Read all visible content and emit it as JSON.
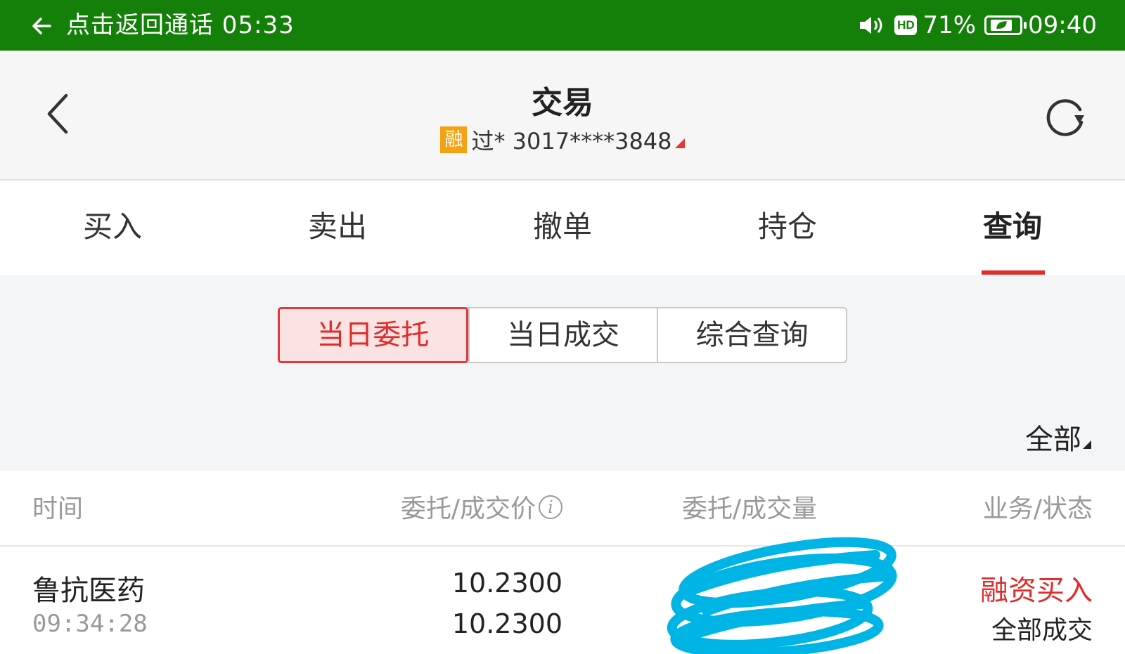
{
  "status_bar": {
    "call_text": "点击返回通话 05:33",
    "hd": "HD",
    "battery": "71%",
    "time": "09:40"
  },
  "header": {
    "title": "交易",
    "badge": "融",
    "account": "过* 3017****3848"
  },
  "tabs": [
    "买入",
    "卖出",
    "撤单",
    "持仓",
    "查询"
  ],
  "active_tab": "查询",
  "segments": [
    "当日委托",
    "当日成交",
    "综合查询"
  ],
  "active_segment": "当日委托",
  "filter": "全部",
  "table": {
    "headers": [
      "时间",
      "委托/成交价",
      "委托/成交量",
      "业务/状态"
    ],
    "rows": [
      {
        "name": "鲁抗医药",
        "time": "09:34:28",
        "order_price": "10.2300",
        "deal_price": "10.2300",
        "business": "融资买入",
        "status": "全部成交"
      }
    ]
  },
  "colors": {
    "status_bar": "#14800a",
    "accent_red": "#e02b2b",
    "badge_orange": "#f5a114",
    "scribble_blue": "#00b4e6"
  }
}
